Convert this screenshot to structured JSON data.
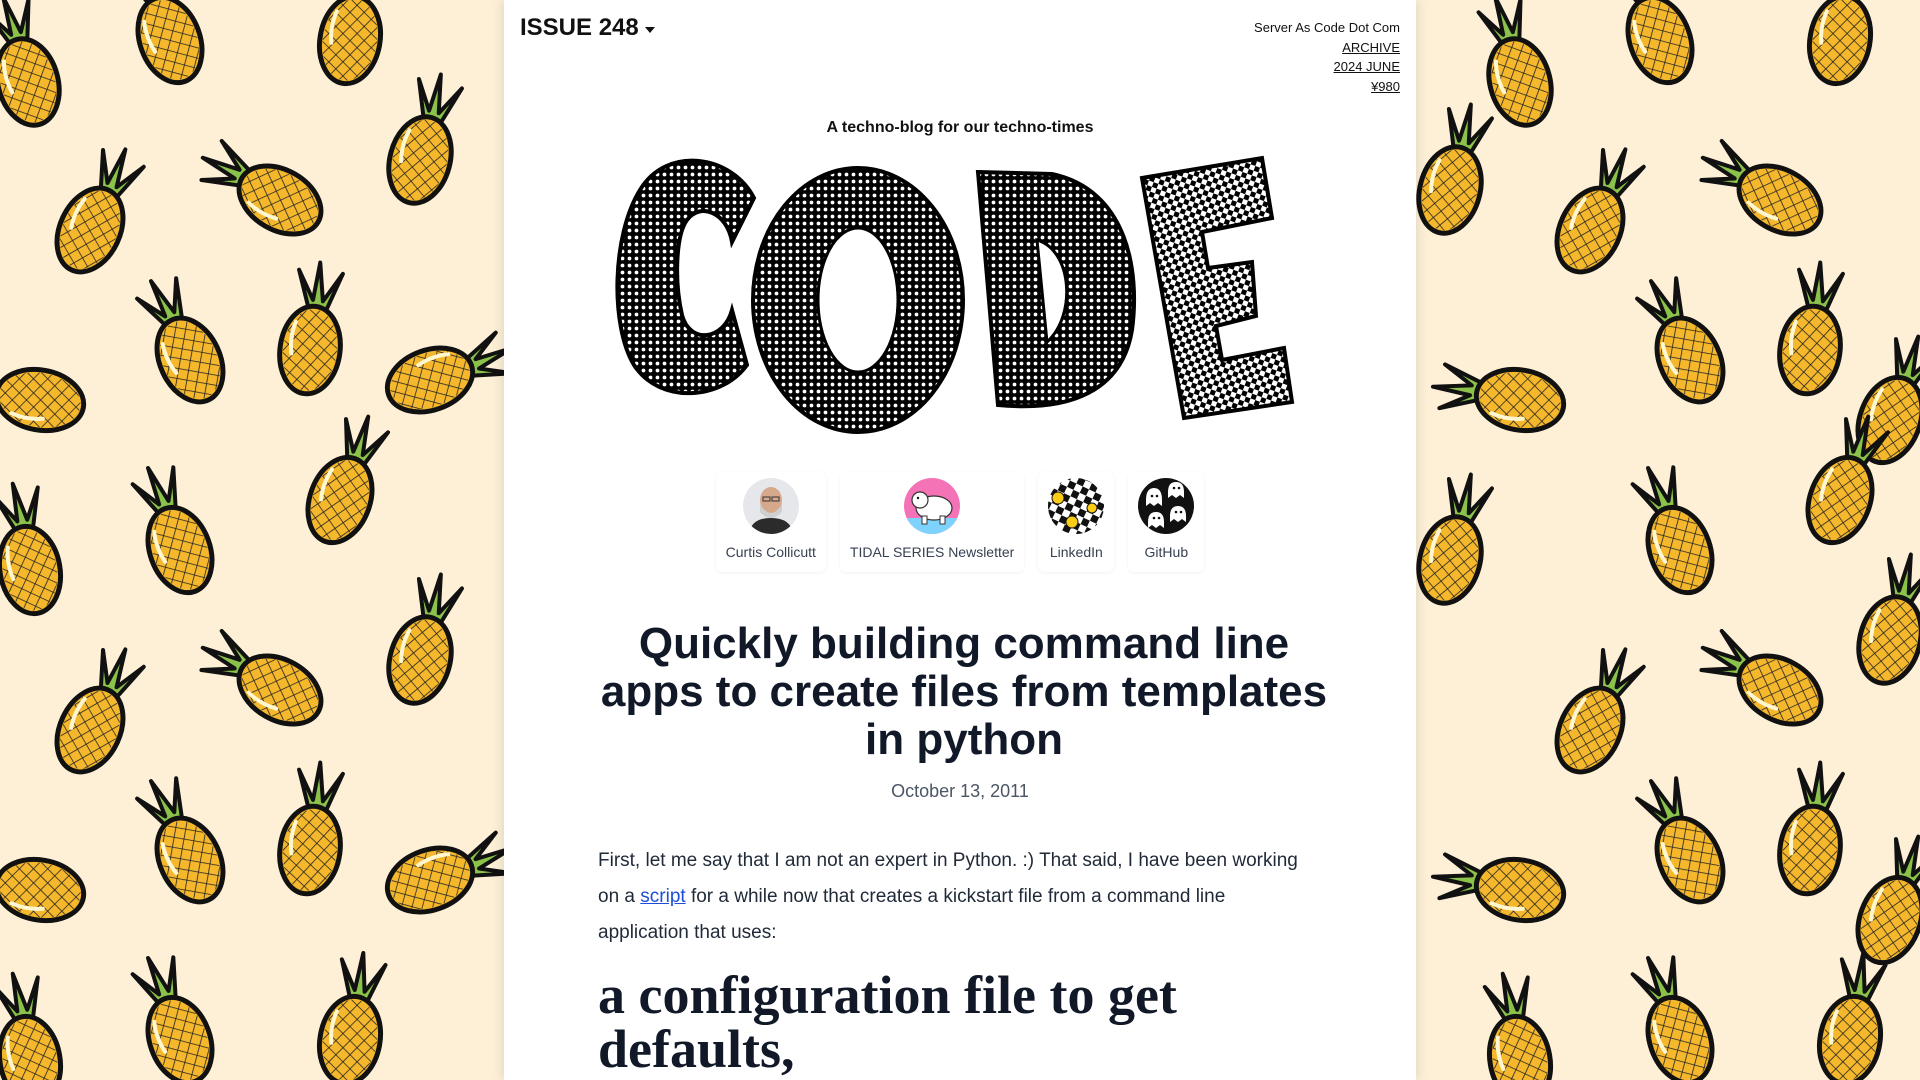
{
  "header": {
    "issue_label": "ISSUE 248",
    "site_name": "Server As Code Dot Com",
    "archive_link": "ARCHIVE",
    "edition_link": "2024 JUNE",
    "price_link": "¥980"
  },
  "tagline": "A techno-blog for our techno-times",
  "logo_text": "CODE",
  "links": [
    {
      "label": "Curtis Collicutt",
      "icon": "avatar-portrait-icon"
    },
    {
      "label": "TIDAL SERIES Newsletter",
      "icon": "polar-bear-icon"
    },
    {
      "label": "LinkedIn",
      "icon": "checkerboard-smiley-icon"
    },
    {
      "label": "GitHub",
      "icon": "ghost-pattern-icon"
    }
  ],
  "post": {
    "title": "Quickly building command line apps to create files from templates in python",
    "date": "October 13, 2011",
    "intro_before_link": "First, let me say that I am not an expert in Python. :) That said, I have been working on a ",
    "intro_link": "script",
    "intro_after_link": " for a while now that creates a kickstart file from a command line application that uses:",
    "heading": "a configuration file to get defaults,"
  },
  "colors": {
    "background": "#fdf0d7",
    "pineapple_body": "#f5b72c",
    "pineapple_leaves": "#7cb342",
    "link": "#1d4ed8"
  }
}
